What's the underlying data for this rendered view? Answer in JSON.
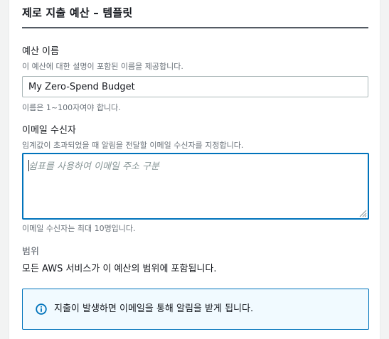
{
  "section": {
    "title": "제로 지출 예산 – 템플릿"
  },
  "budget_name": {
    "label": "예산 이름",
    "description": "이 예산에 대한 설명이 포함된 이름을 제공합니다.",
    "value": "My Zero-Spend Budget",
    "constraint": "이름은 1~100자여야 합니다."
  },
  "email_recipients": {
    "label": "이메일 수신자",
    "description": "임계값이 초과되었을 때 알림을 전달할 이메일 수신자를 지정합니다.",
    "placeholder": "쉼표를 사용하여 이메일 주소 구분",
    "value": "",
    "constraint": "이메일 수신자는 최대 10명입니다."
  },
  "scope": {
    "label": "범위",
    "value": "모든 AWS 서비스가 이 예산의 범위에 포함됩니다."
  },
  "info_alert": {
    "icon": "info-icon",
    "text": "지출이 발생하면 이메일을 통해 알림을 받게 됩니다."
  },
  "colors": {
    "accent": "#0073bb",
    "info_background": "#f1faff",
    "secondary_text": "#687078"
  }
}
